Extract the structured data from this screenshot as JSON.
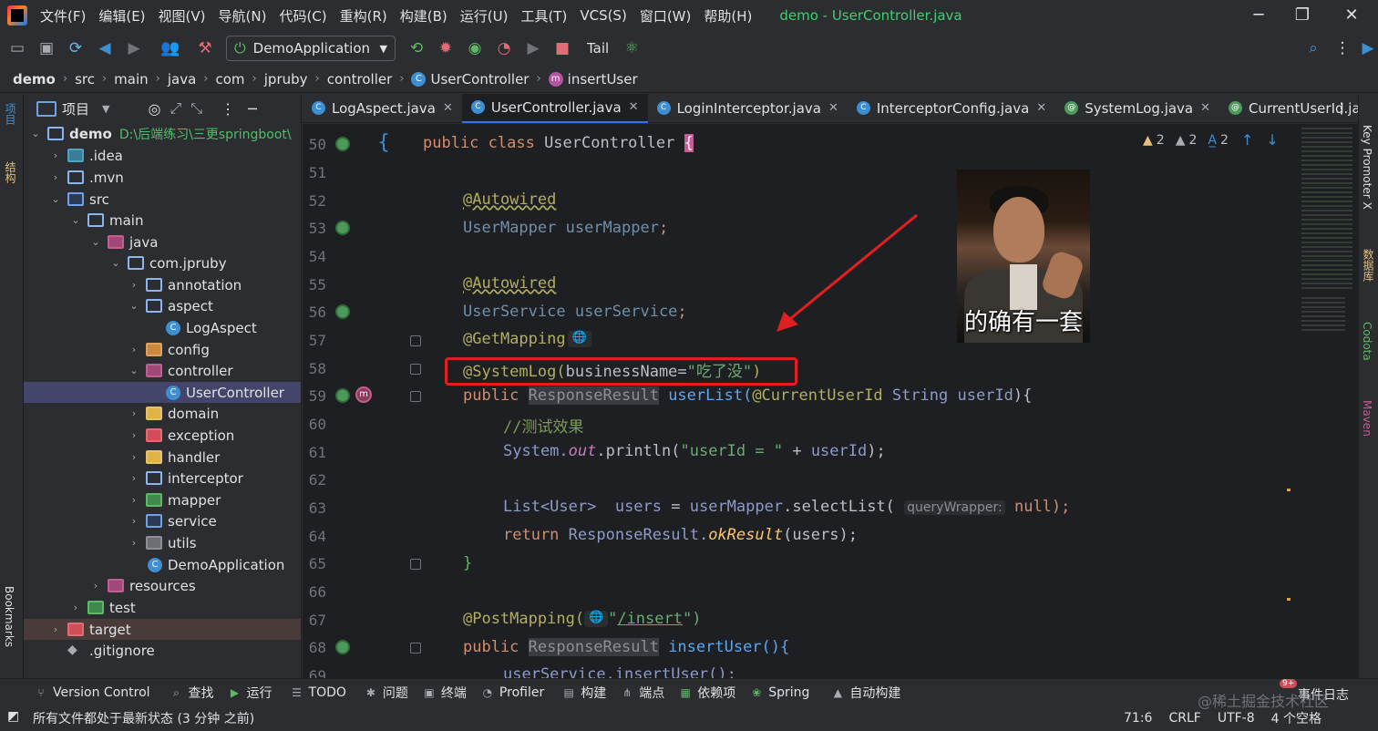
{
  "app": {
    "window_title": "demo - UserController.java"
  },
  "menu": [
    "文件(F)",
    "编辑(E)",
    "视图(V)",
    "导航(N)",
    "代码(C)",
    "重构(R)",
    "构建(B)",
    "运行(U)",
    "工具(T)",
    "VCS(S)",
    "窗口(W)",
    "帮助(H)"
  ],
  "toolbar": {
    "run_config": "DemoApplication",
    "tail_label": "Tail"
  },
  "breadcrumb": [
    "demo",
    "src",
    "main",
    "java",
    "com",
    "jpruby",
    "controller",
    "UserController",
    "insertUser"
  ],
  "left_strip": {
    "project_label": "项目",
    "structure_label": "结构",
    "bookmarks_label": "Bookmarks"
  },
  "project": {
    "header": "项目",
    "root_name": "demo",
    "root_path": "D:\\后端练习\\三更springboot\\",
    "items": [
      ".idea",
      ".mvn",
      "src",
      "main",
      "java",
      "com.jpruby",
      "annotation",
      "aspect",
      "LogAspect",
      "config",
      "controller",
      "UserController",
      "domain",
      "exception",
      "handler",
      "interceptor",
      "mapper",
      "service",
      "utils",
      "DemoApplication",
      "resources",
      "test",
      "target",
      ".gitignore"
    ]
  },
  "tabs": [
    "LogAspect.java",
    "UserController.java",
    "LoginInterceptor.java",
    "InterceptorConfig.java",
    "SystemLog.java",
    "CurrentUserId.java"
  ],
  "editor": {
    "line_numbers": [
      "50",
      "51",
      "52",
      "53",
      "54",
      "55",
      "56",
      "57",
      "58",
      "59",
      "60",
      "61",
      "62",
      "63",
      "64",
      "65",
      "66",
      "67",
      "68",
      "69"
    ],
    "lines": {
      "l50a": "public class ",
      "l50b": "UserController ",
      "l50c": "{",
      "l52": "@Autowired",
      "l53a": "UserMapper ",
      "l53b": "userMapper",
      "l53c": ";",
      "l55": "@Autowired",
      "l56a": "UserService ",
      "l56b": "userService",
      "l56c": ";",
      "l57": "@GetMapping",
      "l58a": "@SystemLog(",
      "l58b": "businessName",
      "l58c": "=",
      "l58d": "\"吃了没\"",
      "l58e": ")",
      "l59a": "public ",
      "l59b": "ResponseResult",
      "l59c": " userList(",
      "l59d": "@CurrentUserId ",
      "l59e": "String ",
      "l59f": "userId",
      "l59g": "){",
      "l60": "//测试效果",
      "l61a": "System.",
      "l61b": "out",
      "l61c": ".println(",
      "l61d": "\"userId = \"",
      "l61e": " + ",
      "l61f": "userId",
      "l61g": ");",
      "l63a": "List<User>  ",
      "l63b": "users",
      "l63c": " = ",
      "l63d": "userMapper",
      "l63e": ".selectList( ",
      "l63f": "queryWrapper:",
      "l63g": " null);",
      "l64a": "return ",
      "l64b": "ResponseResult.",
      "l64c": "okResult",
      "l64d": "(users);",
      "l65": "}",
      "l67a": "@PostMapping(",
      "l67b": "\"",
      "l67c": "/insert",
      "l67d": "\")",
      "l68a": "public ",
      "l68b": "ResponseResult",
      "l68c": " insertUser(){",
      "l69": "userService.insertUser();"
    },
    "inspections": {
      "warn1": "2",
      "warn2": "2",
      "typo": "2"
    },
    "meme_caption": "的确有一套"
  },
  "right_strip": [
    "Key Promoter X",
    "数据库",
    "Codota",
    "Maven"
  ],
  "bottom_tools": [
    "Version Control",
    "查找",
    "运行",
    "TODO",
    "问题",
    "终端",
    "Profiler",
    "构建",
    "端点",
    "依赖项",
    "Spring",
    "自动构建"
  ],
  "event_log": "事件日志",
  "event_badge": "9+",
  "status": {
    "message": "所有文件都处于最新状态 (3 分钟 之前)",
    "position": "71:6",
    "line_sep": "CRLF",
    "encoding": "UTF-8",
    "indent": "4 个空格"
  },
  "watermark": "@稀土掘金技术社区",
  "colors": {
    "accent": "#3574f0",
    "selection": "#43456b",
    "annotation": "#b3ae60",
    "keyword": "#cf8e6d",
    "string": "#6aab73",
    "red_box": "#e02020"
  }
}
